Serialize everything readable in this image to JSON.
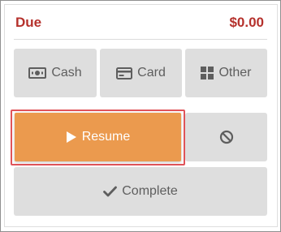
{
  "due": {
    "label": "Due",
    "amount": "$0.00"
  },
  "payment_methods": [
    {
      "label": "Cash",
      "icon": "cash-icon"
    },
    {
      "label": "Card",
      "icon": "credit-card-icon"
    },
    {
      "label": "Other",
      "icon": "grid-icon"
    }
  ],
  "actions": {
    "resume_label": "Resume",
    "resume_icon": "play-icon",
    "cancel_icon": "ban-icon",
    "complete_label": "Complete",
    "complete_icon": "checkmark-icon"
  },
  "colors": {
    "due_text": "#b5312c",
    "resume_bg": "#eb9a4e",
    "highlight_outline": "#e0545a",
    "button_bg": "#dedede",
    "button_text": "#5e5e5e"
  }
}
